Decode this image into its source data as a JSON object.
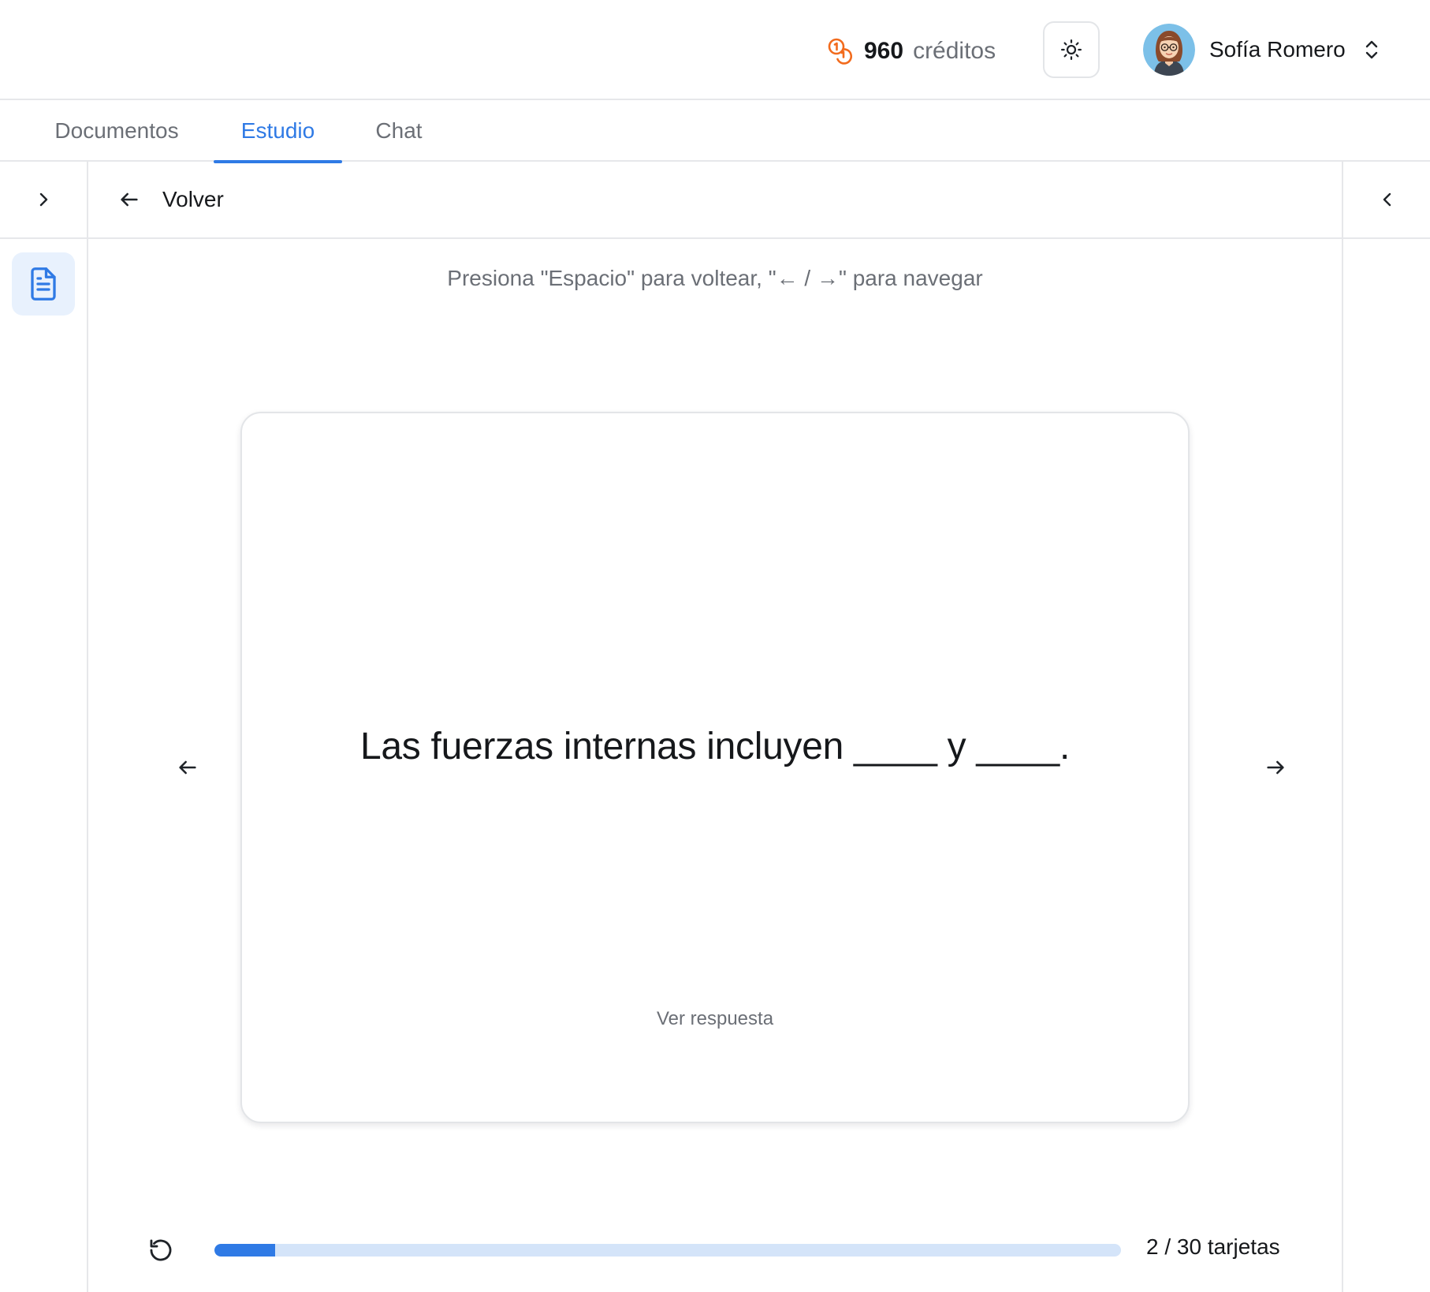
{
  "header": {
    "credits_value": "960",
    "credits_label": "créditos",
    "user_name": "Sofía Romero"
  },
  "tabs": [
    {
      "label": "Documentos",
      "active": false
    },
    {
      "label": "Estudio",
      "active": true
    },
    {
      "label": "Chat",
      "active": false
    }
  ],
  "study": {
    "back_label": "Volver",
    "hint": "Presiona \"Espacio\" para voltear, \"← / →\" para navegar",
    "card": {
      "question": "Las fuerzas internas incluyen ____ y ____.",
      "reveal_label": "Ver respuesta"
    },
    "progress": {
      "current": 2,
      "total": 30,
      "label": "2 / 30 tarjetas"
    }
  },
  "colors": {
    "accent": "#2f7ae5",
    "progress_track": "#d4e4f9",
    "credits_icon": "#f26b1d"
  }
}
